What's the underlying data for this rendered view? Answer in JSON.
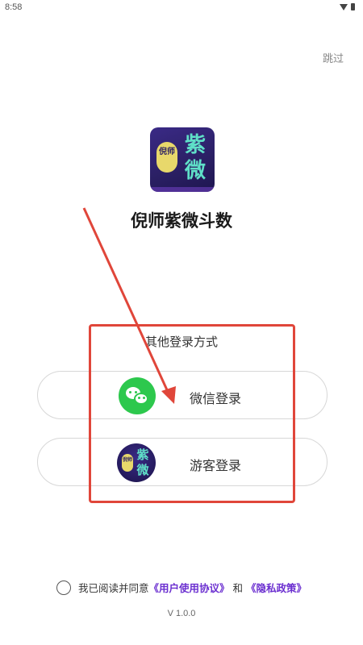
{
  "status_bar": {
    "time": "8:58",
    "wifi_icon": "wifi-icon",
    "battery_icon": "battery-icon"
  },
  "header": {
    "skip_label": "跳过"
  },
  "app": {
    "logo_icon": "app-logo-icon",
    "logo_seal_text": "倪师",
    "logo_big_text": "紫微",
    "name": "倪师紫微斗数"
  },
  "login": {
    "heading": "其他登录方式",
    "wechat": {
      "label": "微信登录",
      "icon": "wechat-icon",
      "color": "#2dc84d"
    },
    "guest": {
      "label": "游客登录",
      "icon": "app-logo-icon"
    }
  },
  "agreement": {
    "prefix": "我已阅读并同意",
    "user_agreement": "《用户使用协议》",
    "conjunction": "和",
    "privacy_policy": "《隐私政策》",
    "link_color": "#6b2fd0"
  },
  "footer": {
    "version": "V 1.0.0"
  },
  "annotation": {
    "color": "#e0463a"
  }
}
